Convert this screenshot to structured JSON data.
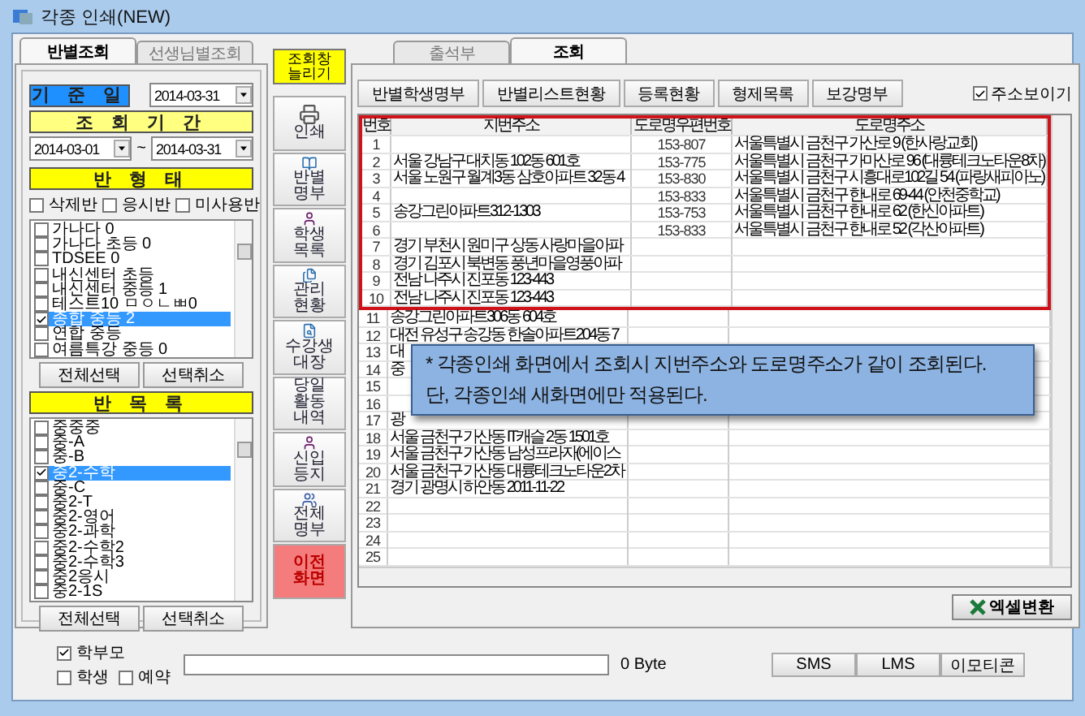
{
  "window": {
    "title": "각종 인쇄(NEW)"
  },
  "left_tabs": [
    {
      "label": "반별조회",
      "selected": true
    },
    {
      "label": "선생님별조회",
      "selected": false
    }
  ],
  "base_date": {
    "label": "기 준 일",
    "value": "2014-03-31"
  },
  "period": {
    "label": "조 회 기 간",
    "from": "2014-03-01",
    "separator": "~",
    "to": "2014-03-31"
  },
  "class_type": {
    "title": "반 형 태",
    "filters": [
      {
        "label": "삭제반",
        "checked": false
      },
      {
        "label": "응시반",
        "checked": false
      },
      {
        "label": "미사용반",
        "checked": false
      }
    ],
    "items": [
      {
        "label": "가나다 0",
        "checked": false,
        "selected": false
      },
      {
        "label": "가나다 초등 0",
        "checked": false,
        "selected": false
      },
      {
        "label": "TDSEE  0",
        "checked": false,
        "selected": false
      },
      {
        "label": "내신센터 초등",
        "checked": false,
        "selected": false
      },
      {
        "label": "내신센터 중등 1",
        "checked": false,
        "selected": false
      },
      {
        "label": "테스트10 ㅁㅇㄴㅃ0",
        "checked": false,
        "selected": false
      },
      {
        "label": "종합 중등 2",
        "checked": true,
        "selected": true
      },
      {
        "label": "연합 중등",
        "checked": false,
        "selected": false
      },
      {
        "label": "여름특강 중등 0",
        "checked": false,
        "selected": false
      }
    ],
    "buttons": [
      "전체선택",
      "선택취소"
    ]
  },
  "class_list": {
    "title": "반 목 록",
    "items": [
      {
        "label": "중중중",
        "checked": false,
        "selected": false
      },
      {
        "label": "중-A",
        "checked": false,
        "selected": false
      },
      {
        "label": "중-B",
        "checked": false,
        "selected": false
      },
      {
        "label": "중2-수학",
        "checked": true,
        "selected": true
      },
      {
        "label": "중-C",
        "checked": false,
        "selected": false
      },
      {
        "label": "중2-T",
        "checked": false,
        "selected": false
      },
      {
        "label": "중2-영어",
        "checked": false,
        "selected": false
      },
      {
        "label": "중2-과학",
        "checked": false,
        "selected": false
      },
      {
        "label": "중2-수학2",
        "checked": false,
        "selected": false
      },
      {
        "label": "중2-수학3",
        "checked": false,
        "selected": false
      },
      {
        "label": "중2응시",
        "checked": false,
        "selected": false
      },
      {
        "label": "중2-1S",
        "checked": false,
        "selected": false
      }
    ],
    "buttons": [
      "전체선택",
      "선택취소"
    ]
  },
  "side_buttons": [
    {
      "kind": "toggle",
      "label": "조회창\n늘리기"
    },
    {
      "kind": "printer",
      "label": "인쇄"
    },
    {
      "kind": "book",
      "label": "반별\n명부"
    },
    {
      "kind": "person",
      "label": "학생\n목록"
    },
    {
      "kind": "docs",
      "label": "관리\n현황"
    },
    {
      "kind": "search",
      "label": "수강생\n대장"
    },
    {
      "kind": "plain",
      "label": "당일\n활동\n내역"
    },
    {
      "kind": "person",
      "label": "신입\n등지"
    },
    {
      "kind": "people",
      "label": "전체\n명부"
    },
    {
      "kind": "back",
      "label": "이전\n화면"
    }
  ],
  "right_tabs": [
    {
      "label": "출석부",
      "selected": false
    },
    {
      "label": "조회",
      "selected": true
    }
  ],
  "report_buttons": [
    "반별학생명부",
    "반별리스트현황",
    "등록현황",
    "형제목록",
    "보강명부"
  ],
  "show_address": {
    "label": "주소보이기",
    "checked": true
  },
  "table": {
    "columns": [
      "번호",
      "지번주소",
      "도로명우편번호",
      "도로명주소"
    ],
    "rows": [
      [
        "1",
        "",
        "153-807",
        "서울특별시 금천구 가산로 9 (한사랑교회)"
      ],
      [
        "2",
        "서울 강남구 대치동 102동 601호",
        "153-775",
        "서울특별시 금천구 가마산로 96 (대륭테크노타운8차)"
      ],
      [
        "3",
        "서울 노원구 월계3동 삼호아파트 32동 4",
        "153-830",
        "서울특별시 금천구 시흥대로102길 54 (파랑새피아노)"
      ],
      [
        "4",
        "",
        "153-833",
        "서울특별시 금천구 한내로 69-44 (안천중학교)"
      ],
      [
        "5",
        "송강그린아파트312-1303",
        "153-753",
        "서울특별시 금천구 한내로 62 (한신아파트)"
      ],
      [
        "6",
        "",
        "153-833",
        "서울특별시 금천구 한내로 52 (각산아파트)"
      ],
      [
        "7",
        "경기 부천시 원미구 상동 사랑마을아파",
        "",
        ""
      ],
      [
        "8",
        "경기 김포시 북변동 풍년마을영풍아파",
        "",
        ""
      ],
      [
        "9",
        "전남 나주시 진포동 123-443",
        "",
        ""
      ],
      [
        "10",
        "전남 나주시 진포동 123-443",
        "",
        ""
      ],
      [
        "11",
        "송강그린아파트306동 604호",
        "",
        ""
      ],
      [
        "12",
        "대전 유성구 송강동 한솔아파트204동 7",
        "",
        ""
      ],
      [
        "13",
        "대",
        "",
        ""
      ],
      [
        "14",
        "중",
        "",
        ""
      ],
      [
        "15",
        "",
        "",
        ""
      ],
      [
        "16",
        "",
        "",
        ""
      ],
      [
        "17",
        "광",
        "",
        ""
      ],
      [
        "18",
        "서울 금천구 가산동 IT캐슬 2동 1501호",
        "",
        ""
      ],
      [
        "19",
        "서울 금천구 가산동 남성프라자(에이스",
        "",
        ""
      ],
      [
        "20",
        "서울 금천구 가산동 대륭테크노타운2차",
        "",
        ""
      ],
      [
        "21",
        "경기 광명시 하안동 2011-11-22",
        "",
        ""
      ],
      [
        "22",
        "",
        "",
        ""
      ],
      [
        "23",
        "",
        "",
        ""
      ],
      [
        "24",
        "",
        "",
        ""
      ],
      [
        "25",
        "",
        "",
        ""
      ]
    ]
  },
  "notice": [
    "* 각종인쇄 화면에서 조회시 지번주소와 도로명주소가 같이 조회된다.",
    "단, 각종인쇄 새화면에만 적용된다."
  ],
  "excel_button": "엑셀변환",
  "bottom": {
    "recipients": [
      {
        "label": "학부모",
        "checked": true
      },
      {
        "label": "학생",
        "checked": false
      },
      {
        "label": "예약",
        "checked": false
      }
    ],
    "byte_count": "0 Byte",
    "buttons": [
      "SMS",
      "LMS",
      "이모티콘"
    ]
  }
}
